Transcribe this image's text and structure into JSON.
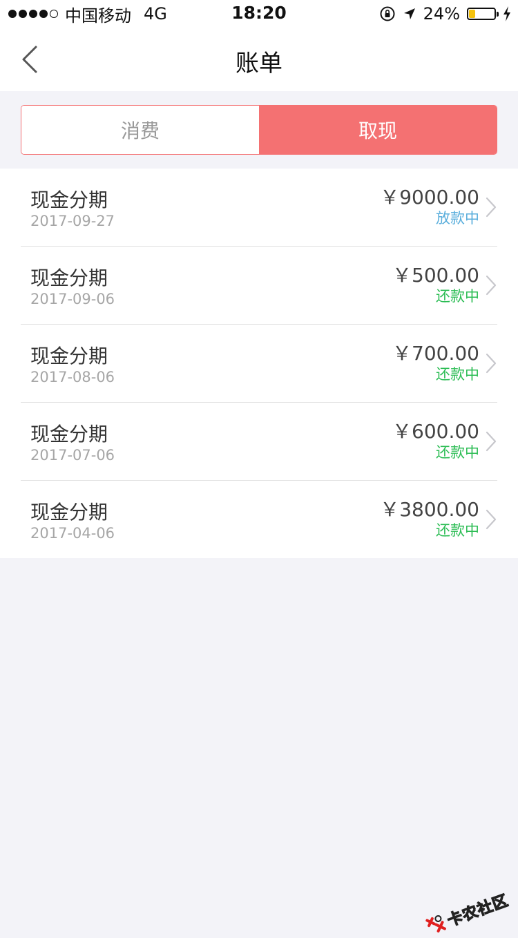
{
  "status_bar": {
    "carrier": "中国移动",
    "network": "4G",
    "time": "18:20",
    "battery_percent_text": "24%",
    "battery_level": 0.24,
    "battery_color": "#f4c20d"
  },
  "nav": {
    "title": "账单",
    "back_icon": "chevron-left-icon"
  },
  "segments": {
    "tabs": [
      {
        "label": "消费",
        "active": false
      },
      {
        "label": "取现",
        "active": true
      }
    ],
    "accent_color": "#f47172"
  },
  "bills": [
    {
      "title": "现金分期",
      "date": "2017-09-27",
      "amount": "￥9000.00",
      "status": "放款中",
      "status_color": "#5aaedc"
    },
    {
      "title": "现金分期",
      "date": "2017-09-06",
      "amount": "￥500.00",
      "status": "还款中",
      "status_color": "#2dbd55"
    },
    {
      "title": "现金分期",
      "date": "2017-08-06",
      "amount": "￥700.00",
      "status": "还款中",
      "status_color": "#2dbd55"
    },
    {
      "title": "现金分期",
      "date": "2017-07-06",
      "amount": "￥600.00",
      "status": "还款中",
      "status_color": "#2dbd55"
    },
    {
      "title": "现金分期",
      "date": "2017-04-06",
      "amount": "￥3800.00",
      "status": "还款中",
      "status_color": "#2dbd55"
    }
  ],
  "watermark": {
    "text": "卡农社区"
  }
}
